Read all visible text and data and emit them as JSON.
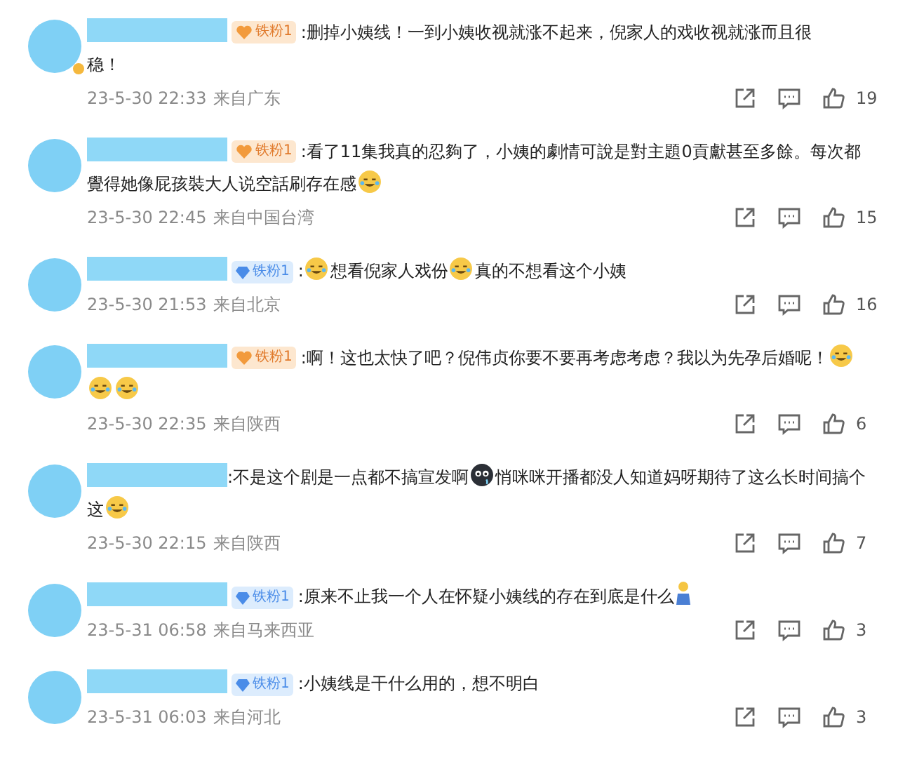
{
  "comments": [
    {
      "avatar_badge": true,
      "fan_badge": {
        "kind": "heart",
        "label": "铁粉1"
      },
      "lines": [
        [
          {
            "kind": "text",
            "text": ":删掉小姨线！一到小姨收视就涨不起来，倪家人的戏收视就涨而且很"
          }
        ],
        [
          {
            "kind": "text",
            "text": "稳！"
          }
        ]
      ],
      "time": "23-5-30 22:33",
      "location": "来自广东",
      "likes": "19"
    },
    {
      "avatar_badge": false,
      "fan_badge": {
        "kind": "heart",
        "label": "铁粉1"
      },
      "lines": [
        [
          {
            "kind": "text",
            "text": ":看了11集我真的忍夠了，小姨的劇情可說是對主題0貢獻甚至多餘。每次都"
          }
        ],
        [
          {
            "kind": "text",
            "text": "覺得她像屁孩裝大人说空話刷存在感"
          },
          {
            "kind": "emoji"
          }
        ]
      ],
      "time": "23-5-30 22:45",
      "location": "来自中国台湾",
      "likes": "15"
    },
    {
      "avatar_badge": false,
      "fan_badge": {
        "kind": "diamond",
        "label": "铁粉1"
      },
      "lines": [
        [
          {
            "kind": "text",
            "text": ":"
          },
          {
            "kind": "emoji"
          },
          {
            "kind": "text",
            "text": "想看倪家人戏份"
          },
          {
            "kind": "emoji"
          },
          {
            "kind": "text",
            "text": "真的不想看这个小姨"
          }
        ]
      ],
      "time": "23-5-30 21:53",
      "location": "来自北京",
      "likes": "16"
    },
    {
      "avatar_badge": false,
      "fan_badge": {
        "kind": "heart",
        "label": "铁粉1"
      },
      "lines": [
        [
          {
            "kind": "text",
            "text": ":啊！这也太快了吧？倪伟贞你要不要再考虑考虑？我以为先孕后婚呢！"
          },
          {
            "kind": "emoji"
          }
        ],
        [
          {
            "kind": "emoji"
          },
          {
            "kind": "emoji"
          }
        ]
      ],
      "time": "23-5-30 22:35",
      "location": "来自陕西",
      "likes": "6"
    },
    {
      "avatar_badge": false,
      "lines": [
        [
          {
            "kind": "text",
            "text": ":不是这个剧是一点都不搞宣发啊"
          },
          {
            "kind": "dark-emoji"
          },
          {
            "kind": "text",
            "text": "悄咪咪开播都没人知道妈呀期待了这么长时间搞个"
          }
        ],
        [
          {
            "kind": "text",
            "text": "这"
          },
          {
            "kind": "emoji"
          }
        ]
      ],
      "time": "23-5-30 22:15",
      "location": "来自陕西",
      "likes": "7"
    },
    {
      "avatar_badge": false,
      "fan_badge": {
        "kind": "diamond",
        "label": "铁粉1"
      },
      "lines": [
        [
          {
            "kind": "text",
            "text": ":原来不止我一个人在怀疑小姨线的存在到底是什么"
          },
          {
            "kind": "figure"
          }
        ]
      ],
      "time": "23-5-31 06:58",
      "location": "来自马来西亚",
      "likes": "3"
    },
    {
      "avatar_badge": false,
      "fan_badge": {
        "kind": "diamond",
        "label": "铁粉1"
      },
      "lines": [
        [
          {
            "kind": "text",
            "text": ":小姨线是干什么用的，想不明白"
          }
        ]
      ],
      "time": "23-5-31 06:03",
      "location": "来自河北",
      "likes": "3"
    }
  ]
}
